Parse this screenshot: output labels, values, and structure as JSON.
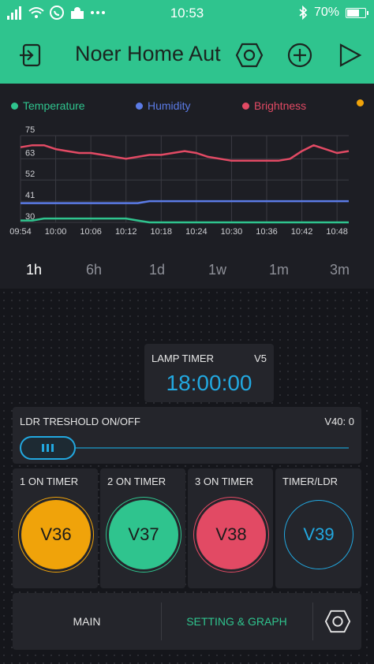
{
  "status_bar": {
    "time": "10:53",
    "battery": "70%",
    "battery_level": 0.7
  },
  "header": {
    "title": "Noer Home Aut",
    "icons": [
      "back-icon",
      "hexagon-settings-icon",
      "add-icon",
      "play-icon"
    ]
  },
  "chart_data": {
    "type": "line",
    "x": [
      "09:54",
      "09:56",
      "09:58",
      "10:00",
      "10:02",
      "10:04",
      "10:06",
      "10:08",
      "10:10",
      "10:12",
      "10:14",
      "10:16",
      "10:18",
      "10:20",
      "10:22",
      "10:24",
      "10:26",
      "10:28",
      "10:30",
      "10:32",
      "10:34",
      "10:36",
      "10:38",
      "10:40",
      "10:42",
      "10:44",
      "10:46",
      "10:48",
      "10:50"
    ],
    "x_tick_labels": [
      "09:54",
      "10:00",
      "10:06",
      "10:12",
      "10:18",
      "10:24",
      "10:30",
      "10:36",
      "10:42",
      "10:48"
    ],
    "y_tick_labels": [
      "75",
      "63",
      "52",
      "41",
      "30"
    ],
    "ylim": [
      30,
      75
    ],
    "grid": true,
    "legend_position": "top",
    "series": [
      {
        "name": "Temperature",
        "color": "#2fc48e",
        "values": [
          31,
          31,
          32,
          32,
          32,
          32,
          32,
          32,
          32,
          32,
          31,
          30,
          30,
          30,
          30,
          30,
          30,
          30,
          30,
          30,
          30,
          30,
          30,
          30,
          30,
          30,
          30,
          30,
          30
        ]
      },
      {
        "name": "Humidity",
        "color": "#5b7be6",
        "values": [
          40,
          40,
          40,
          40,
          40,
          40,
          40,
          40,
          40,
          40,
          40,
          41,
          41,
          41,
          41,
          41,
          41,
          41,
          41,
          41,
          41,
          41,
          41,
          41,
          41,
          41,
          41,
          41,
          41
        ]
      },
      {
        "name": "Brightness",
        "color": "#e24a64",
        "values": [
          69,
          70,
          70,
          68,
          67,
          66,
          66,
          65,
          64,
          63,
          64,
          65,
          65,
          66,
          67,
          66,
          64,
          63,
          62,
          62,
          62,
          62,
          62,
          63,
          67,
          70,
          68,
          66,
          67
        ]
      },
      {
        "name": "",
        "color": "#f0a30a",
        "values": []
      }
    ]
  },
  "ranges": {
    "options": [
      "1h",
      "6h",
      "1d",
      "1w",
      "1m",
      "3m"
    ],
    "selected": "1h"
  },
  "lamp_timer": {
    "label": "LAMP TIMER",
    "pin": "V5",
    "value": "18:00:00"
  },
  "ldr_slider": {
    "label": "LDR TRESHOLD ON/OFF",
    "pin_value": "V40: 0",
    "level": 0
  },
  "timer_buttons": [
    {
      "label": "1 ON TIMER",
      "pin": "V36",
      "color": "#f0a30a",
      "filled": true
    },
    {
      "label": "2 ON TIMER",
      "pin": "V37",
      "color": "#2fc48e",
      "filled": true
    },
    {
      "label": "3 ON TIMER",
      "pin": "V38",
      "color": "#e24a64",
      "filled": true
    },
    {
      "label": "TIMER/LDR",
      "pin": "V39",
      "color": "#22a8e0",
      "filled": false
    }
  ],
  "tabs": {
    "items": [
      "MAIN",
      "SETTING & GRAPH"
    ],
    "active": "SETTING & GRAPH",
    "active_color": "#2fc48e"
  }
}
